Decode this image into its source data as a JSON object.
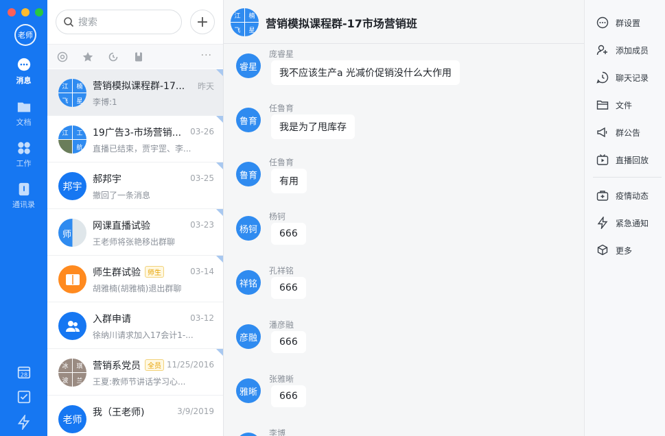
{
  "colors": {
    "accent": "#1677f2",
    "avatar_blue": "#2f8bf0",
    "badge": "#e6a100"
  },
  "rail": {
    "user_avatar": "老师",
    "items": [
      {
        "label": "消息",
        "icon": "chat-bubble-icon",
        "active": true
      },
      {
        "label": "文档",
        "icon": "folder-icon",
        "active": false
      },
      {
        "label": "工作",
        "icon": "apps-grid-icon",
        "active": false
      },
      {
        "label": "通讯录",
        "icon": "contacts-book-icon",
        "active": false
      }
    ],
    "bottom_icons": [
      "calendar-icon",
      "checkbox-icon",
      "lightning-icon"
    ],
    "calendar_day": "28"
  },
  "list": {
    "search_placeholder": "搜索",
    "add_button": "+",
    "filter_icons": [
      "at-icon",
      "star-icon",
      "history-icon",
      "bookmark-icon"
    ],
    "filter_more": "···",
    "conversations": [
      {
        "title": "营销模拟课程群-17...",
        "time": "昨天",
        "subtitle": "李博:1",
        "avatar": [
          "江",
          "楠",
          "飞",
          "星"
        ],
        "badge": ""
      },
      {
        "title": "19广告3-市场营销...",
        "time": "03-26",
        "subtitle": "直播已结束，贾宇罡、李...",
        "avatar": [
          "江",
          "工",
          "",
          "航"
        ],
        "badge": ""
      },
      {
        "title": "郝邦宇",
        "time": "03-25",
        "subtitle": "撤回了一条消息",
        "avatar_text": "邦宇",
        "badge": ""
      },
      {
        "title": "网课直播试验",
        "time": "03-23",
        "subtitle": "王老师将张艳移出群聊",
        "avatar_text": "师",
        "badge": ""
      },
      {
        "title": "师生群试验",
        "time": "03-14",
        "subtitle": "胡雅楠(胡雅楠)退出群聊",
        "avatar_text": "师生",
        "badge": "师生"
      },
      {
        "title": "入群申请",
        "time": "03-12",
        "subtitle": "徐纳川请求加入17会计1-...",
        "avatar_text": "",
        "badge": ""
      },
      {
        "title": "营销系党员",
        "time": "11/25/2016",
        "subtitle": "王夏:教师节讲话学习心...",
        "avatar": [
          "冰",
          "琪",
          "波",
          "兰"
        ],
        "badge": "全员"
      },
      {
        "title": "我（王老师)",
        "time": "3/9/2019",
        "subtitle": "",
        "avatar_text": "老师",
        "badge": ""
      }
    ]
  },
  "chat": {
    "title": "营销模拟课程群-17市场营销班",
    "header_avatar": [
      "江",
      "楠",
      "飞",
      "星"
    ],
    "messages": [
      {
        "avatar": "睿星",
        "name": "庞睿星",
        "text": "我不应该生产a  光减价促销没什么大作用"
      },
      {
        "avatar": "鲁育",
        "name": "任鲁育",
        "text": "我是为了甩库存"
      },
      {
        "avatar": "鲁育",
        "name": "任鲁育",
        "text": "有用"
      },
      {
        "avatar": "杨钶",
        "name": "杨钶",
        "text": "666"
      },
      {
        "avatar": "祥铭",
        "name": "孔祥铭",
        "text": "666"
      },
      {
        "avatar": "彦融",
        "name": "潘彦融",
        "text": "666"
      },
      {
        "avatar": "雅晰",
        "name": "张雅晰",
        "text": "666"
      },
      {
        "avatar": "",
        "name": "李博",
        "text": ""
      }
    ]
  },
  "side": {
    "items": [
      {
        "label": "群设置",
        "icon": "more-circle-icon"
      },
      {
        "label": "添加成员",
        "icon": "add-user-icon"
      },
      {
        "label": "聊天记录",
        "icon": "clock-bubble-icon"
      },
      {
        "label": "文件",
        "icon": "folder-outline-icon"
      },
      {
        "label": "群公告",
        "icon": "megaphone-icon"
      },
      {
        "label": "直播回放",
        "icon": "tv-play-icon"
      },
      {
        "label": "疫情动态",
        "icon": "medical-kit-icon"
      },
      {
        "label": "紧急通知",
        "icon": "lightning-outline-icon"
      },
      {
        "label": "更多",
        "icon": "cube-plus-icon"
      }
    ]
  }
}
